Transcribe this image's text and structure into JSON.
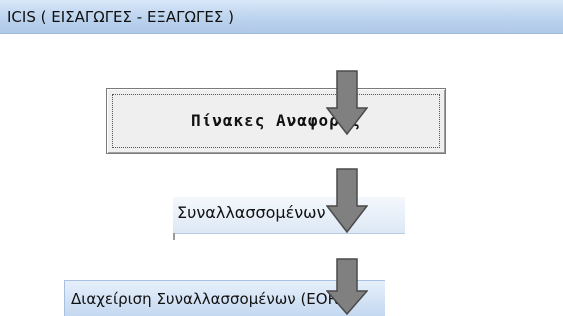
{
  "window": {
    "title": "ICIS ( ΕΙΣΑΓΩΓΕΣ - ΕΞΑΓΩΓΕΣ )"
  },
  "menu_button": {
    "label": "Πίνακες Αναφοράς"
  },
  "submenu": {
    "item_label": "Συναλλασσομένων"
  },
  "form": {
    "title": "Διαχείριση Συναλλασσομένων (EORI)"
  },
  "arrows": {
    "count": 3,
    "fill_color": "#808080",
    "stroke_color": "#4a4a4a",
    "icon": "down-arrow-icon"
  }
}
